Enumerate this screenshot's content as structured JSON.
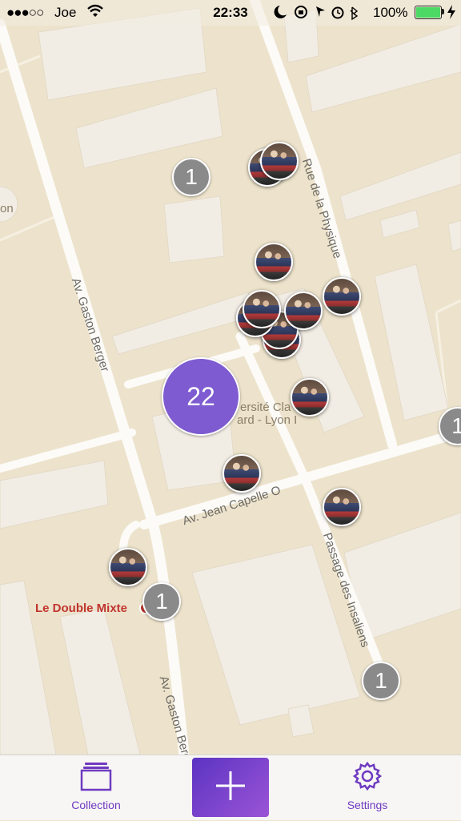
{
  "status_bar": {
    "signal": "●●●○○",
    "carrier": "Joe",
    "time": "22:33",
    "battery_percent": "100%",
    "battery_level": 1.0
  },
  "map": {
    "streets": [
      {
        "name": "Av. Gaston Berger"
      },
      {
        "name": "Av. Gaston Berger"
      },
      {
        "name": "Rue de la Physique"
      },
      {
        "name": "Av. Jean Capelle O"
      },
      {
        "name": "Passage des Insaliens"
      }
    ],
    "pois": [
      {
        "name": "on"
      },
      {
        "name": "ersité Cla"
      },
      {
        "name": "ard - Lyon I"
      }
    ],
    "poi_red": "Le Double Mixte",
    "clusters": [
      {
        "count": "1",
        "color": "gray"
      },
      {
        "count": "22",
        "color": "purple"
      },
      {
        "count": "1",
        "color": "gray"
      },
      {
        "count": "1",
        "color": "gray"
      },
      {
        "count": "1",
        "color": "gray"
      }
    ],
    "photo_pin_count": 12
  },
  "tab_bar": {
    "collection_label": "Collection",
    "settings_label": "Settings",
    "add_icon": "plus-icon",
    "accent_color": "#6f3ac0"
  }
}
